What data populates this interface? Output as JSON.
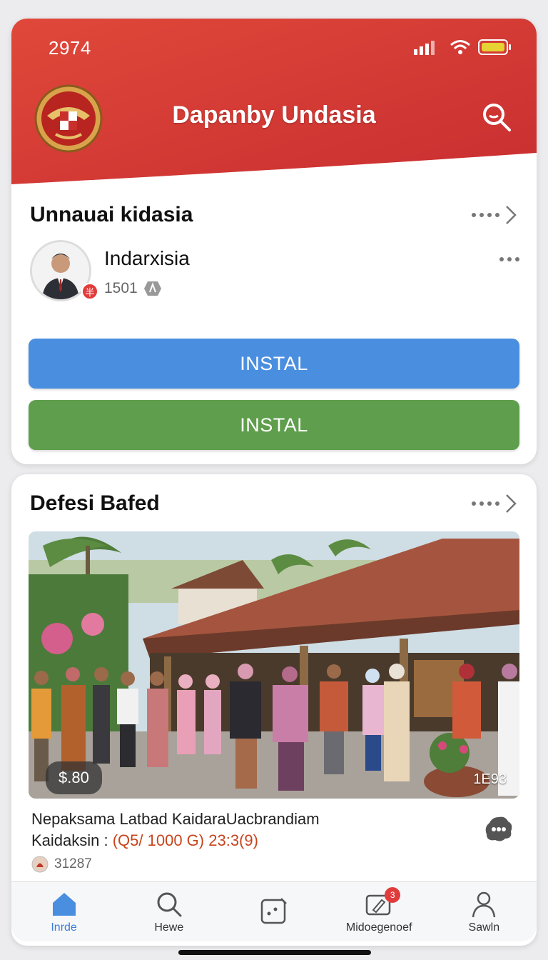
{
  "status": {
    "time": "2974"
  },
  "header": {
    "title": "Dapanby Undasia",
    "colors": {
      "top": "#e0483a",
      "bottom": "#c82e30"
    }
  },
  "section1": {
    "title": "Unnauai kidasia",
    "profile": {
      "name": "Indarxisia",
      "count": "1501",
      "badge": "半"
    },
    "install_blue": "INSTAL",
    "install_green": "INSTAL"
  },
  "section2": {
    "title": "Defesi Bafed",
    "price": "$.80",
    "photo_count": "1E93",
    "post_title": "Nepaksama Latbad KaidaraUacbrandiam",
    "post_sub_prefix": "Kaidaksin : ",
    "post_sub_highlight": "(Q5/ 1000 G) 23:3(9)",
    "meta_count": "31287"
  },
  "tabbar": {
    "tabs": [
      {
        "label": "Inrde",
        "icon": "home-icon"
      },
      {
        "label": "Hewe",
        "icon": "search-icon"
      },
      {
        "label": "",
        "icon": "dice-icon"
      },
      {
        "label": "Midoegenoef",
        "icon": "edit-icon",
        "badge": "3"
      },
      {
        "label": "Sawln",
        "icon": "person-icon"
      }
    ]
  },
  "colors": {
    "accent_blue": "#4a8ee0",
    "accent_green": "#5f9e4c",
    "brand_red": "#d83a34"
  }
}
